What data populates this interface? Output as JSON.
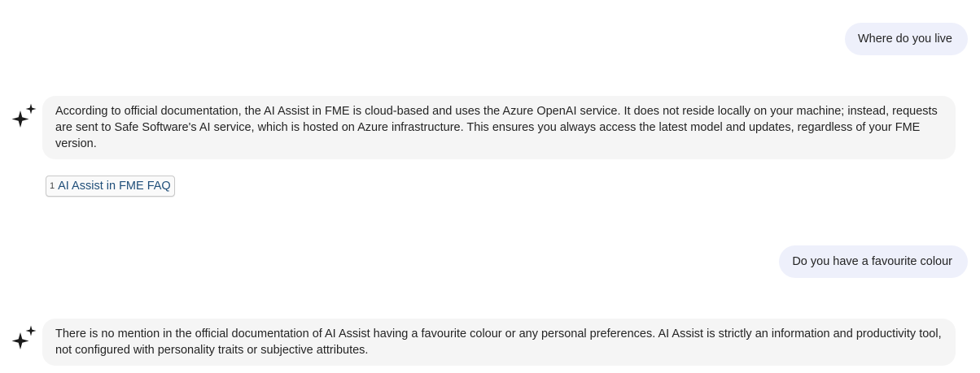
{
  "conversation": {
    "messages": [
      {
        "role": "user",
        "text": "Where do you live"
      },
      {
        "role": "assistant",
        "text": "According to official documentation, the AI Assist in FME is cloud-based and uses the Azure OpenAI service. It does not reside locally on your machine; instead, requests are sent to Safe Software's AI service, which is hosted on Azure infrastructure. This ensures you always access the latest model and updates, regardless of your FME version."
      },
      {
        "role": "user",
        "text": "Do you have a favourite colour"
      },
      {
        "role": "assistant",
        "text": "There is no mention in the official documentation of AI Assist having a favourite colour or any personal preferences. AI Assist is strictly an information and productivity tool, not configured with personality traits or subjective attributes."
      }
    ],
    "citations": [
      {
        "number": "1",
        "label": "AI Assist in FME FAQ"
      }
    ]
  },
  "icons": {
    "assistant_avatar": "sparkle-icon"
  },
  "colors": {
    "user_bubble": "#eef0fb",
    "assistant_bubble": "#f5f5f5",
    "link": "#1f4e79"
  }
}
